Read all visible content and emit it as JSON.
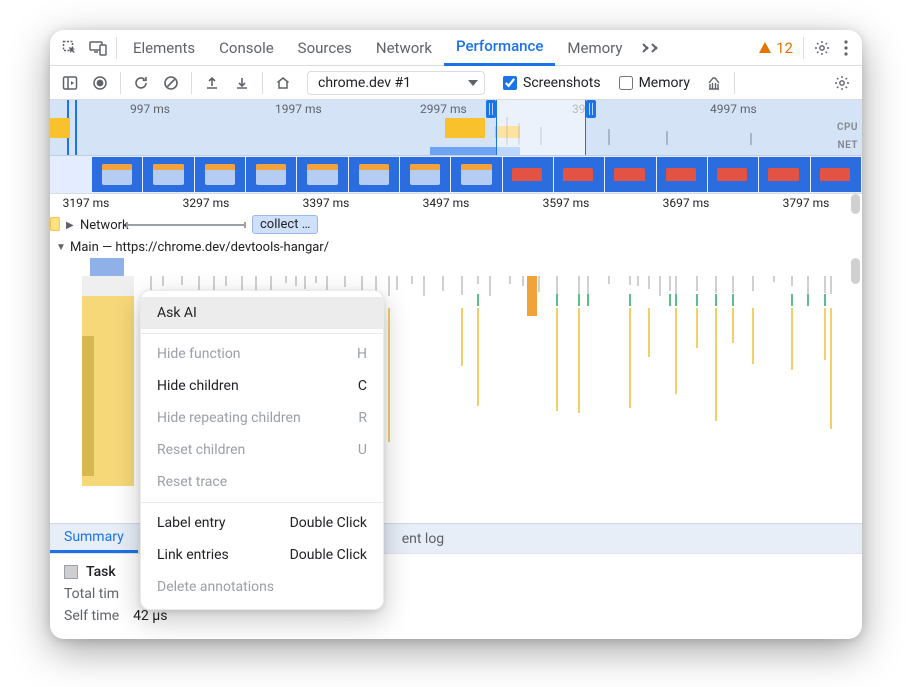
{
  "topbar": {
    "tabs": [
      "Elements",
      "Console",
      "Sources",
      "Network",
      "Performance",
      "Memory"
    ],
    "activeIndex": 4,
    "warnCount": "12"
  },
  "toolbar": {
    "recordingDropdown": "chrome.dev #1",
    "screenshotsLabel": "Screenshots",
    "screenshotsChecked": true,
    "memoryLabel": "Memory",
    "memoryChecked": false
  },
  "overview": {
    "ticks": [
      "997 ms",
      "1997 ms",
      "2997 ms",
      "39",
      "4997 ms"
    ],
    "cpuLabel": "CPU",
    "netLabel": "NET"
  },
  "ruler": {
    "ticks": [
      "3197 ms",
      "3297 ms",
      "3397 ms",
      "3497 ms",
      "3597 ms",
      "3697 ms",
      "3797 ms"
    ]
  },
  "tracks": {
    "networkLabel": "Network",
    "collectLabel": "collect …",
    "mainLabel": "Main — https://chrome.dev/devtools-hangar/"
  },
  "contextMenu": {
    "items": [
      {
        "label": "Ask AI",
        "shortcut": "",
        "state": "highlight"
      },
      {
        "sep": true
      },
      {
        "label": "Hide function",
        "shortcut": "H",
        "state": "disabled"
      },
      {
        "label": "Hide children",
        "shortcut": "C",
        "state": ""
      },
      {
        "label": "Hide repeating children",
        "shortcut": "R",
        "state": "disabled"
      },
      {
        "label": "Reset children",
        "shortcut": "U",
        "state": "disabled"
      },
      {
        "label": "Reset trace",
        "shortcut": "",
        "state": "disabled"
      },
      {
        "sep": true
      },
      {
        "label": "Label entry",
        "shortcut": "Double Click",
        "state": ""
      },
      {
        "label": "Link entries",
        "shortcut": "Double Click",
        "state": ""
      },
      {
        "label": "Delete annotations",
        "shortcut": "",
        "state": "disabled"
      }
    ]
  },
  "bottomTabs": {
    "tabs": [
      "Summary",
      "ent log"
    ],
    "activeIndex": 0
  },
  "details": {
    "taskLabel": "Task",
    "totalTimeLabel": "Total tim",
    "selfTimeLabel": "Self time",
    "selfTimeValue": "42 μs"
  }
}
